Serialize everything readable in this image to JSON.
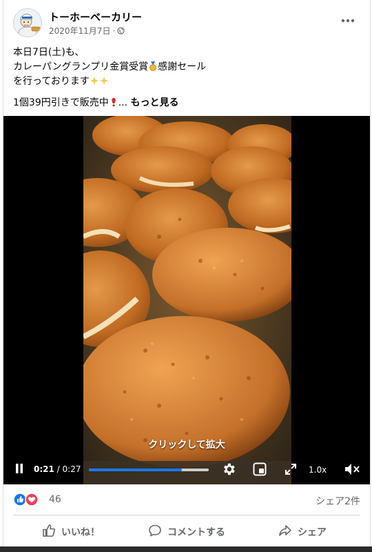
{
  "post": {
    "page_name": "トーホーベーカリー",
    "date": "2020年11月7日",
    "audience_icon": "globe-icon",
    "more_icon": "more-dots-icon",
    "text_lines": [
      "本日7日(土)も、",
      "カレーパングランプリ金賞受賞",
      "感謝セール",
      "を行っております",
      "1個39円引きで販売中"
    ],
    "ellipsis": "...",
    "see_more": "もっと見る"
  },
  "video": {
    "caption": "クリックして拡大",
    "current_time": "0:21",
    "separator": " / ",
    "duration": "0:27",
    "progress": 0.778,
    "speed": "1.0x",
    "controls": [
      "pause-icon",
      "settings-icon",
      "pip-icon",
      "fullscreen-icon",
      "mute-icon"
    ]
  },
  "engagement": {
    "reaction_count": "46",
    "shares": "シェア2件",
    "like_label": "いいね！",
    "comment_label": "コメントする",
    "share_label": "シェア"
  },
  "colors": {
    "brand_blue": "#1877f2",
    "love_red": "#f33e58",
    "secondary_text": "#65676b"
  }
}
